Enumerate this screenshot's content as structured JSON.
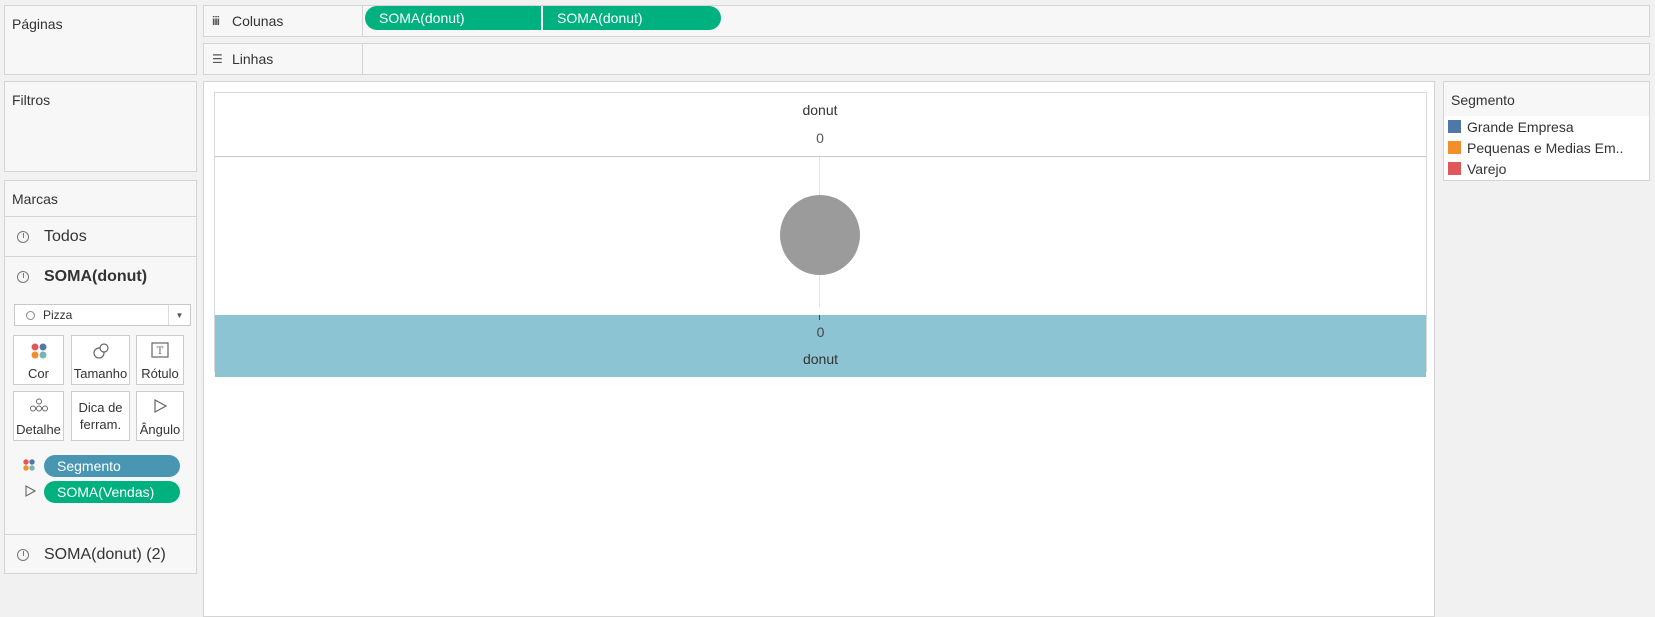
{
  "left_panels": {
    "pages_title": "Páginas",
    "filters_title": "Filtros",
    "marks_title": "Marcas"
  },
  "shelves": {
    "columns_label": "Colunas",
    "columns_icon": "columns-icon",
    "columns_pills": [
      "SOMA(donut)",
      "SOMA(donut)"
    ],
    "rows_label": "Linhas",
    "rows_icon": "rows-icon"
  },
  "marks": {
    "all_label": "Todos",
    "layer1_label": "SOMA(donut)",
    "mark_type": "Pizza",
    "buttons": {
      "color": "Cor",
      "size": "Tamanho",
      "label": "Rótulo",
      "detail": "Detalhe",
      "tooltip_line1": "Dica de",
      "tooltip_line2": "ferram.",
      "angle": "Ângulo"
    },
    "fields": [
      {
        "label": "Segmento",
        "icon": "color-dots-icon",
        "color": "#4996b2"
      },
      {
        "label": "SOMA(Vendas)",
        "icon": "angle-icon",
        "color": "#00b180"
      }
    ],
    "layer2_label": "SOMA(donut) (2)"
  },
  "view": {
    "top_header": "donut",
    "top_axis_tick": "0",
    "bottom_axis_tick": "0",
    "bottom_header": "donut",
    "pie_color": "#9b9b9b",
    "bottom_band_color": "#8cc4d3"
  },
  "legend": {
    "title": "Segmento",
    "items": [
      {
        "label": "Grande Empresa",
        "color": "#4e79a7"
      },
      {
        "label": "Pequenas e Medias Em..",
        "color": "#f28e2b"
      },
      {
        "label": "Varejo",
        "color": "#e15759"
      }
    ]
  }
}
